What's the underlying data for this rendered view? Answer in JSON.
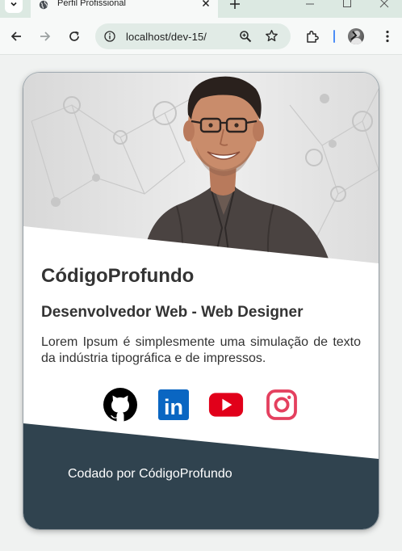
{
  "browser": {
    "tab_title": "Perfil Profissional",
    "url": "localhost/dev-15/"
  },
  "profile": {
    "name": "CódigoProfundo",
    "role": "Desenvolvedor Web - Web Designer",
    "description": "Lorem Ipsum é simplesmente uma simulação de texto da indústria tipográfica e de impressos."
  },
  "socials": [
    {
      "icon": "github-icon"
    },
    {
      "icon": "linkedin-icon",
      "label": "in"
    },
    {
      "icon": "youtube-icon"
    },
    {
      "icon": "instagram-icon"
    }
  ],
  "footer": {
    "text": "Codado por CódigoProfundo"
  },
  "colors": {
    "footer_bg": "#30434f",
    "text": "#333333",
    "linkedin": "#0a66c2",
    "youtube": "#e1001a",
    "instagram": "#e4405f"
  }
}
